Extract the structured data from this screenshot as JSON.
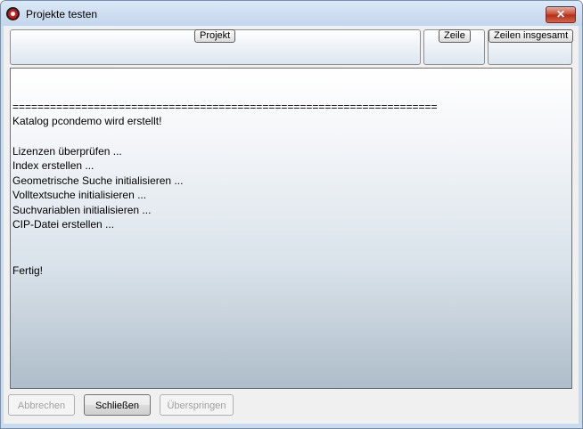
{
  "window": {
    "title": "Projekte testen",
    "close_label": "✕"
  },
  "fields": {
    "projekt_label": "Projekt",
    "zeile_label": "Zeile",
    "zeilen_insgesamt_label": "Zeilen insgesamt"
  },
  "log": {
    "lines": [
      "",
      "",
      "====================================================================",
      "Katalog pcondemo wird erstellt!",
      "",
      "Lizenzen überprüfen ...",
      "Index erstellen ...",
      "Geometrische Suche initialisieren ...",
      "Volltextsuche initialisieren ...",
      "Suchvariablen initialisieren ...",
      "CIP-Datei erstellen ...",
      "",
      "",
      "Fertig!"
    ]
  },
  "buttons": {
    "abbrechen": "Abbrechen",
    "schliessen": "Schließen",
    "ueberspringen": "Überspringen"
  },
  "colors": {
    "window_frame": "#c9dcef",
    "close_button": "#c8452e",
    "log_gradient_bottom": "#aebdca"
  },
  "icons": {
    "app": "app-logo-icon",
    "close": "close-icon"
  }
}
